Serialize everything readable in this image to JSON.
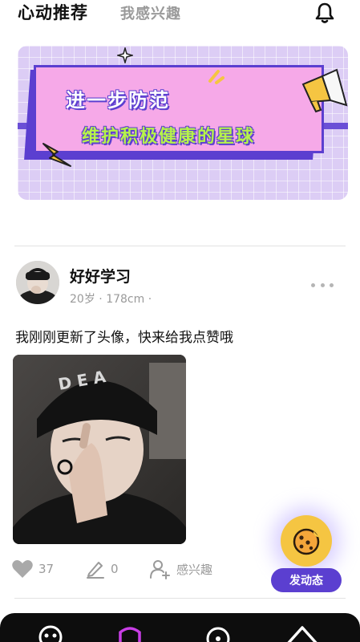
{
  "header": {
    "tab_active": "心动推荐",
    "tab_inactive": "我感兴趣"
  },
  "banner": {
    "line1": "进一步防范",
    "line2": "维护积极健康的星球"
  },
  "post": {
    "username": "好好学习",
    "age": "20岁",
    "height": "178cm",
    "text": "我刚刚更新了头像，快来给我点赞哦",
    "likes": "37",
    "comments": "0",
    "interest_label": "感兴趣"
  },
  "fab": {
    "label": "发动态"
  },
  "colors": {
    "accent": "#5b3fd0",
    "fab_yellow": "#f5c542",
    "banner_pink": "#f6a9e8",
    "banner_green": "#b6f34a",
    "muted": "#9a9a9a"
  },
  "icons": [
    "bell-icon",
    "more-icon",
    "heart-icon",
    "pen-icon",
    "add-user-icon",
    "cookie-icon",
    "megaphone-icon",
    "lightning-icon",
    "sparkle-icon"
  ]
}
